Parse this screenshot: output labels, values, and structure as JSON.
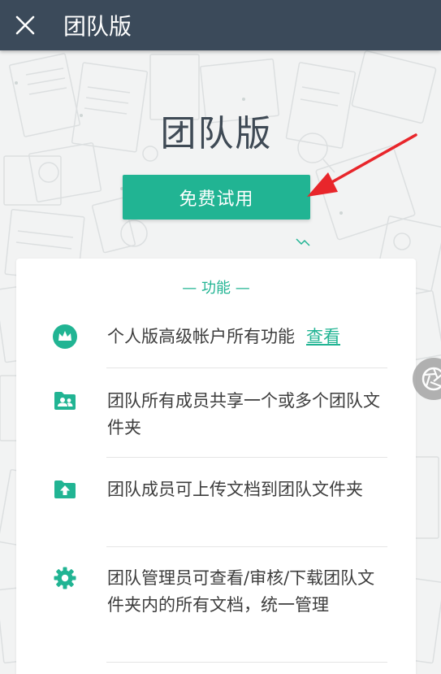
{
  "header": {
    "title": "团队版",
    "close_icon": "close-icon"
  },
  "hero": {
    "title": "团队版",
    "trial_button": "免费试用"
  },
  "features": {
    "section_title": "— 功能 —",
    "items": [
      {
        "icon": "crown-icon",
        "text": "个人版高级帐户所有功能",
        "link": "查看"
      },
      {
        "icon": "shared-folder-icon",
        "text": "团队所有成员共享一个或多个团队文件夹"
      },
      {
        "icon": "upload-folder-icon",
        "text": "团队成员可上传文档到团队文件夹"
      },
      {
        "icon": "gear-icon",
        "text": "团队管理员可查看/审核/下载团队文件夹内的所有文档，统一管理"
      }
    ]
  },
  "colors": {
    "header_bg": "#3b4a5a",
    "accent": "#21b493",
    "arrow": "#e8262b"
  }
}
